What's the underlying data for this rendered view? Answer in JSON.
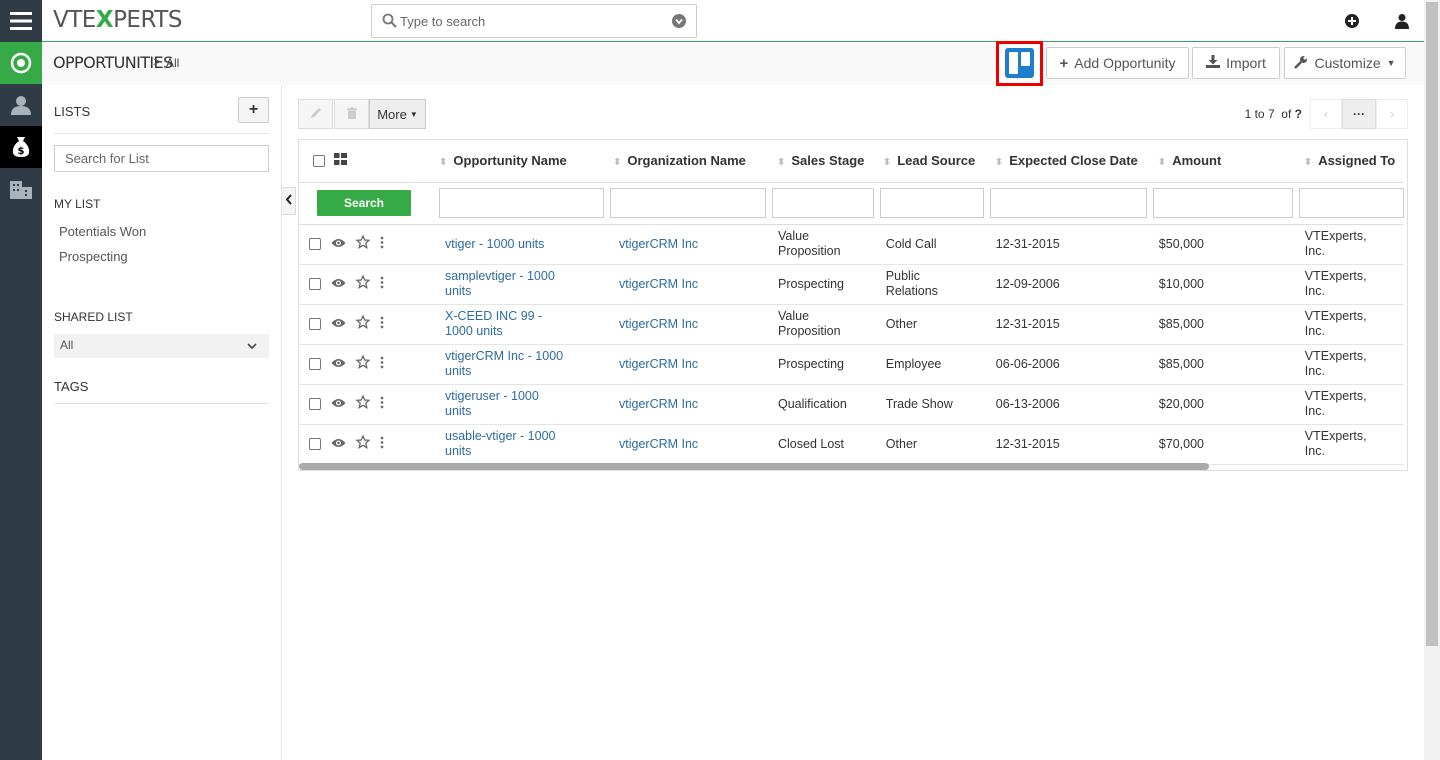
{
  "brand": {
    "logo_text_left": "VTE",
    "logo_text_x": "X",
    "logo_text_right": "PERTS"
  },
  "search": {
    "placeholder": "Type to search"
  },
  "sidebar": {
    "items": [
      {
        "icon": "menu-icon"
      },
      {
        "icon": "target-icon",
        "color": "#35aa47"
      },
      {
        "icon": "user-icon"
      },
      {
        "icon": "money-bag-icon",
        "active": true
      },
      {
        "icon": "building-icon"
      }
    ]
  },
  "header": {
    "module": "OPPORTUNITIES",
    "separator": ">",
    "crumb": "All",
    "add_label": "Add Opportunity",
    "import_label": "Import",
    "customize_label": "Customize"
  },
  "lists": {
    "title": "LISTS",
    "search_placeholder": "Search for List",
    "my_list_title": "MY LIST",
    "my_list": [
      "Potentials Won",
      "Prospecting"
    ],
    "shared_list_title": "SHARED LIST",
    "shared_selected": "All",
    "tags_title": "TAGS"
  },
  "toolbar": {
    "more_label": "More",
    "pager_text": "1 to 7",
    "pager_of": "of",
    "pager_total": "?",
    "dots": "···"
  },
  "table": {
    "search_label": "Search",
    "columns": [
      "Opportunity Name",
      "Organization Name",
      "Sales Stage",
      "Lead Source",
      "Expected Close Date",
      "Amount",
      "Assigned To"
    ],
    "rows": [
      {
        "name": "vtiger - 1000 units",
        "org": "vtigerCRM Inc",
        "stage": "Value Proposition",
        "source": "Cold Call",
        "close": "12-31-2015",
        "amount": "$50,000",
        "assigned": "VTExperts, Inc."
      },
      {
        "name": "samplevtiger - 1000 units",
        "org": "vtigerCRM Inc",
        "stage": "Prospecting",
        "source": "Public Relations",
        "close": "12-09-2006",
        "amount": "$10,000",
        "assigned": "VTExperts, Inc."
      },
      {
        "name": "X-CEED INC 99 - 1000 units",
        "org": "vtigerCRM Inc",
        "stage": "Value Proposition",
        "source": "Other",
        "close": "12-31-2015",
        "amount": "$85,000",
        "assigned": "VTExperts, Inc."
      },
      {
        "name": "vtigerCRM Inc - 1000 units",
        "org": "vtigerCRM Inc",
        "stage": "Prospecting",
        "source": "Employee",
        "close": "06-06-2006",
        "amount": "$85,000",
        "assigned": "VTExperts, Inc."
      },
      {
        "name": "vtigeruser - 1000 units",
        "org": "vtigerCRM Inc",
        "stage": "Qualification",
        "source": "Trade Show",
        "close": "06-13-2006",
        "amount": "$20,000",
        "assigned": "VTExperts, Inc."
      },
      {
        "name": "usable-vtiger - 1000 units",
        "org": "vtigerCRM Inc",
        "stage": "Closed Lost",
        "source": "Other",
        "close": "12-31-2015",
        "amount": "$70,000",
        "assigned": "VTExperts, Inc."
      }
    ]
  },
  "colors": {
    "accent": "#35aa47",
    "sidebar_bg": "#2f3b45",
    "link": "#2d6ca2",
    "highlight": "#ee0000",
    "kanban": "#1e7ecb"
  }
}
